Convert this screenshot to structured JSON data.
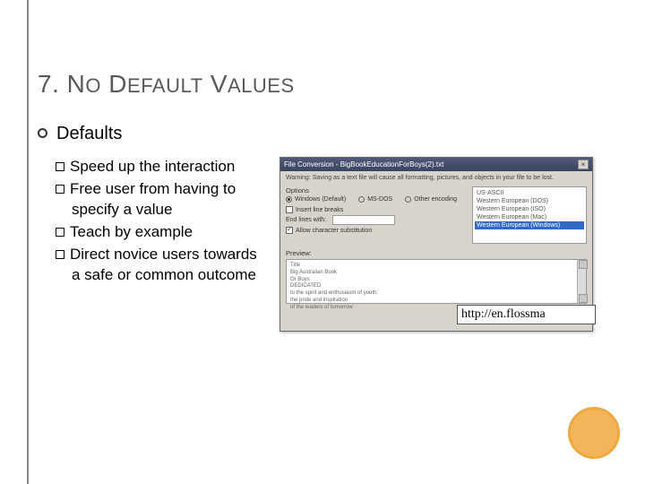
{
  "title": {
    "num": "7. ",
    "word1_cap": "N",
    "word1_rest": "O",
    "space": " ",
    "word2_cap": "D",
    "word2_rest": "EFAULT",
    "word3_cap": "V",
    "word3_rest": "ALUES"
  },
  "main_bullet": "Defaults",
  "items": [
    "Speed up the interaction",
    "Free user from having to specify a value",
    "Teach by example",
    "Direct novice users towards a safe or common outcome"
  ],
  "dialog": {
    "titlebar": "File Conversion - BigBookEducationForBoys(2).txt",
    "warning": "Warning: Saving as a text file will cause all formatting, pictures, and objects in your file to be lost.",
    "group_label": "Options",
    "radios": [
      "Windows (Default)",
      "MS-DOS",
      "Other encoding"
    ],
    "check1": "Insert line breaks",
    "endlines_label": "End lines with:",
    "check2": "Allow character substitution",
    "encodings": [
      "US-ASCII",
      "Western European (DOS)",
      "Western European (ISO)",
      "Western European (Mac)",
      "Western European (Windows)"
    ],
    "preview_label": "Preview:",
    "preview_lines": [
      "Title",
      "Big Australian Book",
      "Or Boys",
      "",
      "DEDICATED",
      "to the spirit and enthusiasm of youth;",
      "the pride and inspiration",
      "of the leaders of tomorrow"
    ]
  },
  "url_overlay": "http://en.flossma"
}
